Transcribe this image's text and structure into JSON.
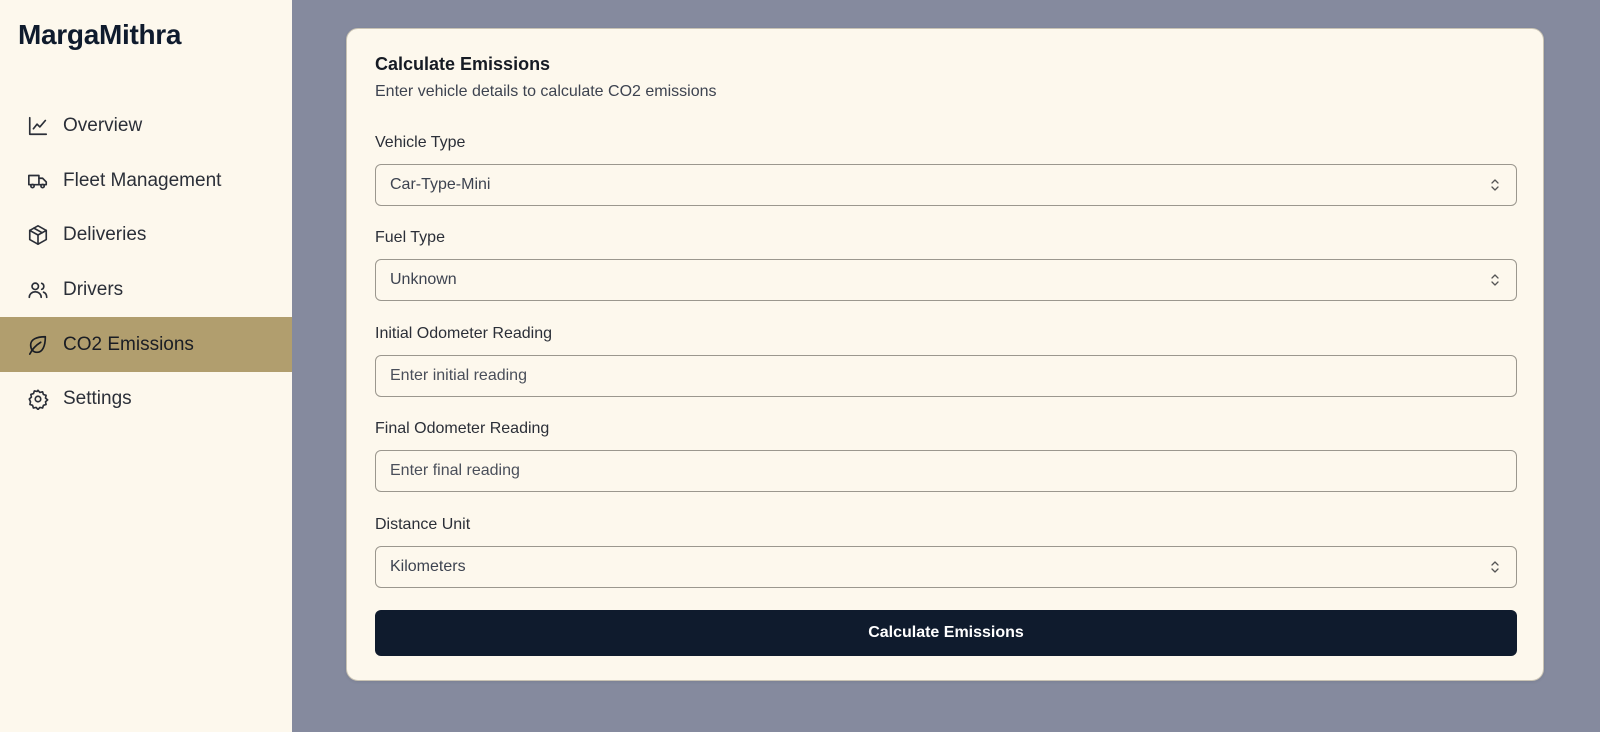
{
  "app": {
    "brand": "MargaMithra"
  },
  "sidebar": {
    "items": [
      {
        "label": "Overview",
        "icon": "chart-line-icon"
      },
      {
        "label": "Fleet Management",
        "icon": "truck-icon"
      },
      {
        "label": "Deliveries",
        "icon": "package-icon"
      },
      {
        "label": "Drivers",
        "icon": "users-icon"
      },
      {
        "label": "CO2 Emissions",
        "icon": "leaf-icon",
        "active": true
      },
      {
        "label": "Settings",
        "icon": "gear-icon"
      }
    ]
  },
  "form": {
    "title": "Calculate Emissions",
    "description": "Enter vehicle details to calculate CO2 emissions",
    "vehicle_type": {
      "label": "Vehicle Type",
      "value": "Car-Type-Mini"
    },
    "fuel_type": {
      "label": "Fuel Type",
      "value": "Unknown"
    },
    "initial_odometer": {
      "label": "Initial Odometer Reading",
      "placeholder": "Enter initial reading"
    },
    "final_odometer": {
      "label": "Final Odometer Reading",
      "placeholder": "Enter final reading"
    },
    "distance_unit": {
      "label": "Distance Unit",
      "value": "Kilometers"
    },
    "submit_label": "Calculate Emissions"
  },
  "colors": {
    "sidebar_bg": "#fdf8ed",
    "main_bg": "#858a9e",
    "active_item": "#b19e6e",
    "primary_button": "#0f1b2d"
  }
}
